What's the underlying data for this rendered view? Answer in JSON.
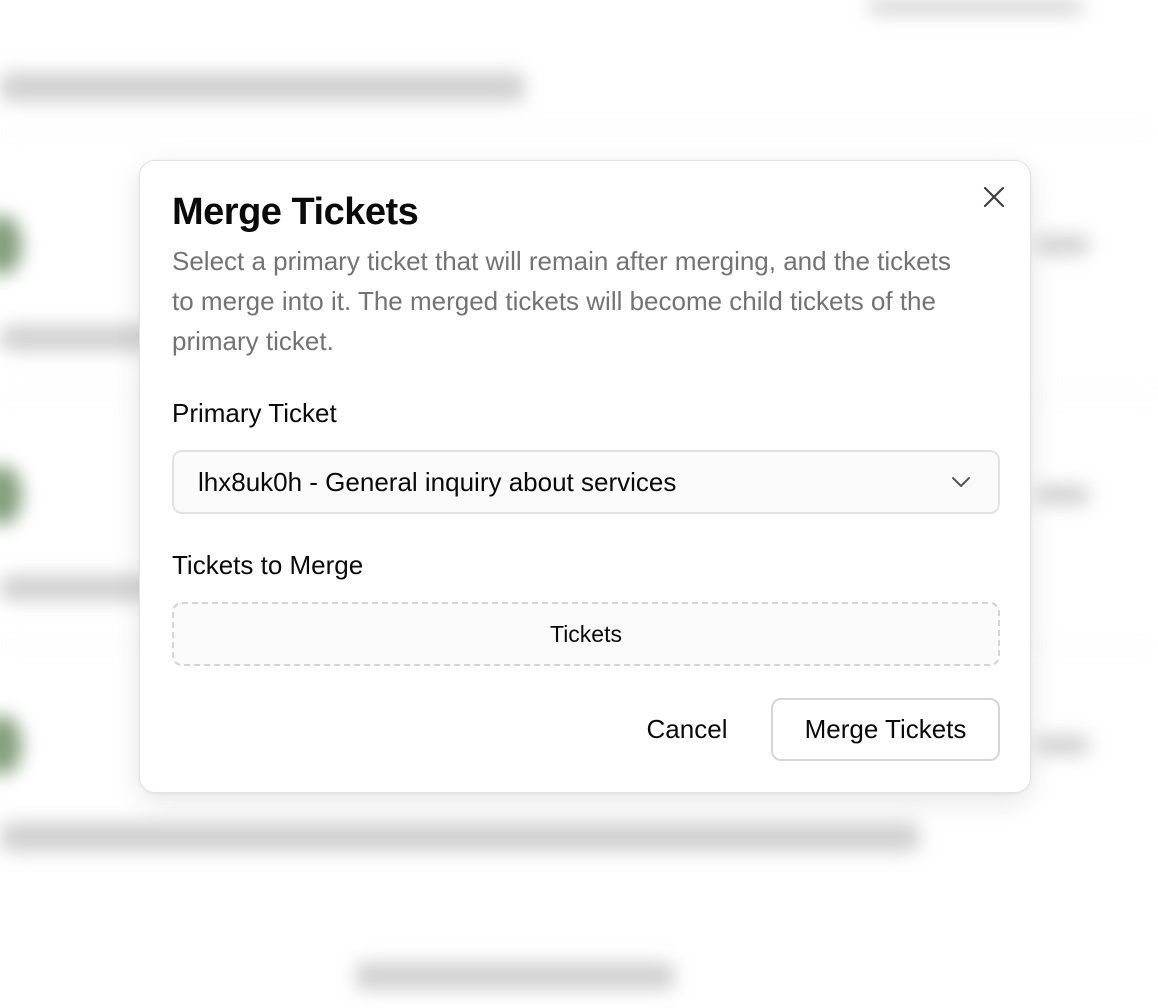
{
  "dialog": {
    "title": "Merge Tickets",
    "description": "Select a primary ticket that will remain after merging, and the tickets to merge into it. The merged tickets will become child tickets of the primary ticket.",
    "close_icon": "close-icon",
    "primary_ticket": {
      "label": "Primary Ticket",
      "selected_value": "lhx8uk0h - General inquiry about services",
      "chevron_icon": "chevron-down-icon"
    },
    "tickets_to_merge": {
      "label": "Tickets to Merge",
      "placeholder": "Tickets"
    },
    "actions": {
      "cancel_label": "Cancel",
      "merge_label": "Merge Tickets"
    }
  },
  "colors": {
    "overlay_background": "#ffffff",
    "text_primary": "#0a0a0a",
    "text_muted": "#737373",
    "border": "#e2e2e2"
  }
}
